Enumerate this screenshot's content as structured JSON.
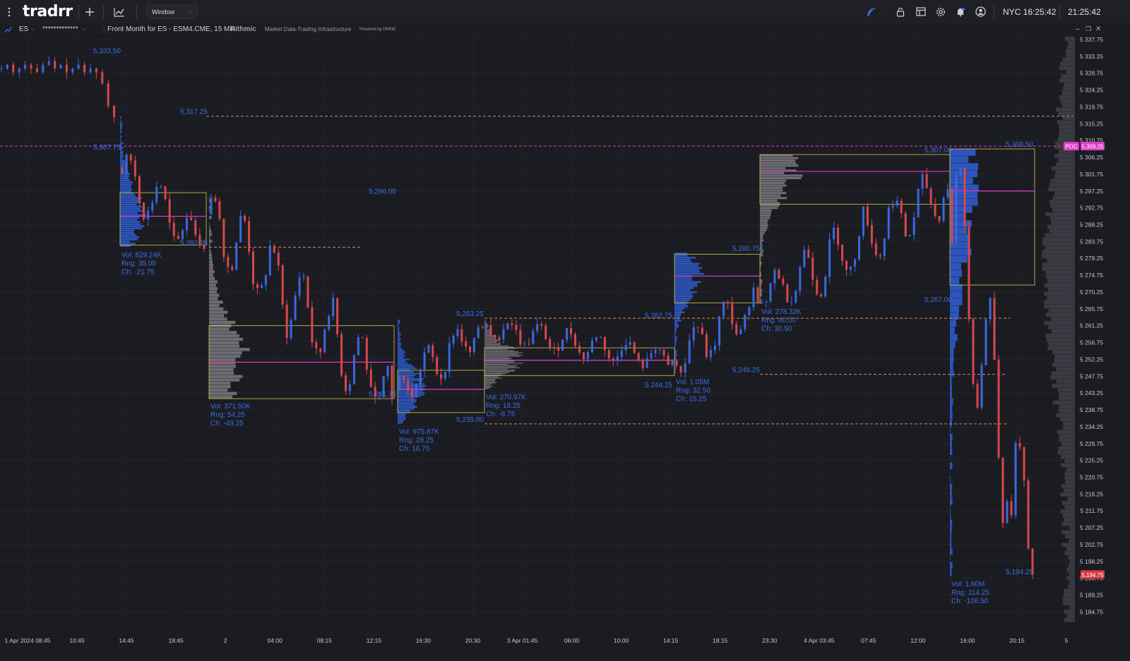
{
  "app": {
    "logo": "tradrr",
    "window_label": "Window",
    "clock_nyc": "NYC 16:25:42",
    "clock_local": "21:25:42"
  },
  "subbar": {
    "symbol": "ES",
    "account": "*************",
    "description": "Front Month for ES - ESM4.CME, 15 Min",
    "provider": "Rithmic",
    "provider_tag": "Market Data-Trading Infrastructure",
    "powered": "Powered by OMNE"
  },
  "icons": [
    "menu-dots-icon",
    "plus-icon",
    "chart-line-icon",
    "chevron-down-icon",
    "signal-icon",
    "lock-icon",
    "layout-icon",
    "gear-icon",
    "bell-icon",
    "user-icon",
    "minimize-icon",
    "restore-icon",
    "close-icon"
  ],
  "colors": {
    "background": "#1b1c22",
    "up": "#3a68e0",
    "down": "#d8484b",
    "poc": "#e03cc8",
    "level": "#e08a4a",
    "volume_profile": "#7a7a80",
    "value_box": "#d8c84a",
    "price_label": "#3a6fe8"
  },
  "chart_data": {
    "type": "candlestick",
    "title": "Front Month for ES - ESM4.CME, 15 Min",
    "ylim": [
      5182.0,
      5338.5
    ],
    "y_ticks": [
      "5 337.75",
      "5 333.25",
      "5 328.75",
      "5 324.25",
      "5 319.75",
      "5 315.25",
      "5 310.75",
      "5 306.25",
      "5 301.75",
      "5 297.25",
      "5 292.75",
      "5 288.25",
      "5 283.75",
      "5 279.25",
      "5 274.75",
      "5 270.25",
      "5 265.75",
      "5 261.25",
      "5 256.75",
      "5 252.25",
      "5 247.75",
      "5 243.25",
      "5 238.75",
      "5 234.25",
      "5 229.75",
      "5 225.25",
      "5 220.75",
      "5 216.25",
      "5 211.75",
      "5 207.25",
      "5 202.75",
      "5 198.25",
      "5 193.75",
      "5 189.25",
      "5 184.75"
    ],
    "x_ticks": [
      "1 Apr 2024 08:45",
      "10:45",
      "14:45",
      "18:45",
      "2",
      "04:00",
      "08:15",
      "12:15",
      "16:30",
      "20:30",
      "3 Apr 01:45",
      "06:00",
      "10:00",
      "14:15",
      "18:15",
      "23:30",
      "4 Apr 03:45",
      "07:45",
      "12:00",
      "16:00",
      "20:15",
      "5"
    ],
    "poc": {
      "label": "POC",
      "value": 5309.25,
      "value_label": "5,309.25"
    },
    "current_price": {
      "value": 5194.75,
      "label": "5,194.75"
    },
    "price_labels": [
      {
        "text": "5,333.50",
        "value": 5333.5
      },
      {
        "text": "5,317.25",
        "value": 5317.25
      },
      {
        "text": "5,307.75",
        "value": 5307.75
      },
      {
        "text": "5,296.00",
        "value": 5296.0
      },
      {
        "text": "5,282.25",
        "value": 5282.25
      },
      {
        "text": "5,263.25",
        "value": 5263.25
      },
      {
        "text": "5,262.75",
        "value": 5262.75
      },
      {
        "text": "5,241.75",
        "value": 5241.75
      },
      {
        "text": "5,235.00",
        "value": 5235.0
      },
      {
        "text": "5,244.25",
        "value": 5244.25
      },
      {
        "text": "5,280.75",
        "value": 5280.75
      },
      {
        "text": "5,248.25",
        "value": 5248.25
      },
      {
        "text": "5,307.00",
        "value": 5307.0
      },
      {
        "text": "5,308.50",
        "value": 5308.5
      },
      {
        "text": "5,267.00",
        "value": 5267.0
      },
      {
        "text": "5,194.25",
        "value": 5194.25
      }
    ],
    "levels": [
      5317.25,
      5282.25,
      5263.25,
      5248.25,
      5235.0
    ],
    "sessions": [
      {
        "vol": "Vol: 829.24K",
        "rng": "Rng: 35.00",
        "ch": "Ch: -21.75",
        "high": 5317.25,
        "low": 5282.25,
        "open": 5303.5,
        "close": 5281.75,
        "poc": 5290.5
      },
      {
        "vol": "Vol: 371.50K",
        "rng": "Rng: 54.25",
        "ch": "Ch: -49.25",
        "high": 5296.0,
        "low": 5241.75,
        "open": 5291.0,
        "close": 5241.75,
        "poc": 5251.5
      },
      {
        "vol": "Vol: 975.87K",
        "rng": "Rng: 28.25",
        "ch": "Ch: 16.75",
        "high": 5263.25,
        "low": 5235.0,
        "open": 5244.0,
        "close": 5260.75,
        "poc": 5244.25
      },
      {
        "vol": "Vol: 270.97K",
        "rng": "Rng: 18.25",
        "ch": "Ch: -8.75",
        "high": 5262.75,
        "low": 5244.25,
        "open": 5260.75,
        "close": 5252.0,
        "poc": 5252.0
      },
      {
        "vol": "Vol: 1.05M",
        "rng": "Rng: 32.50",
        "ch": "Ch: 15.25",
        "high": 5280.75,
        "low": 5248.25,
        "open": 5252.0,
        "close": 5267.25,
        "poc": 5274.5
      },
      {
        "vol": "Vol: 278.32K",
        "rng": "Rng: 40.00",
        "ch": "Ch: 30.50",
        "high": 5307.0,
        "low": 5267.0,
        "open": 5267.25,
        "close": 5297.75,
        "poc": 5302.5
      },
      {
        "vol": "Vol: 1.60M",
        "rng": "Rng: 114.25",
        "ch": "Ch: -106.50",
        "high": 5308.5,
        "low": 5194.25,
        "open": 5297.75,
        "close": 5194.75,
        "poc": 5297.25
      }
    ]
  }
}
